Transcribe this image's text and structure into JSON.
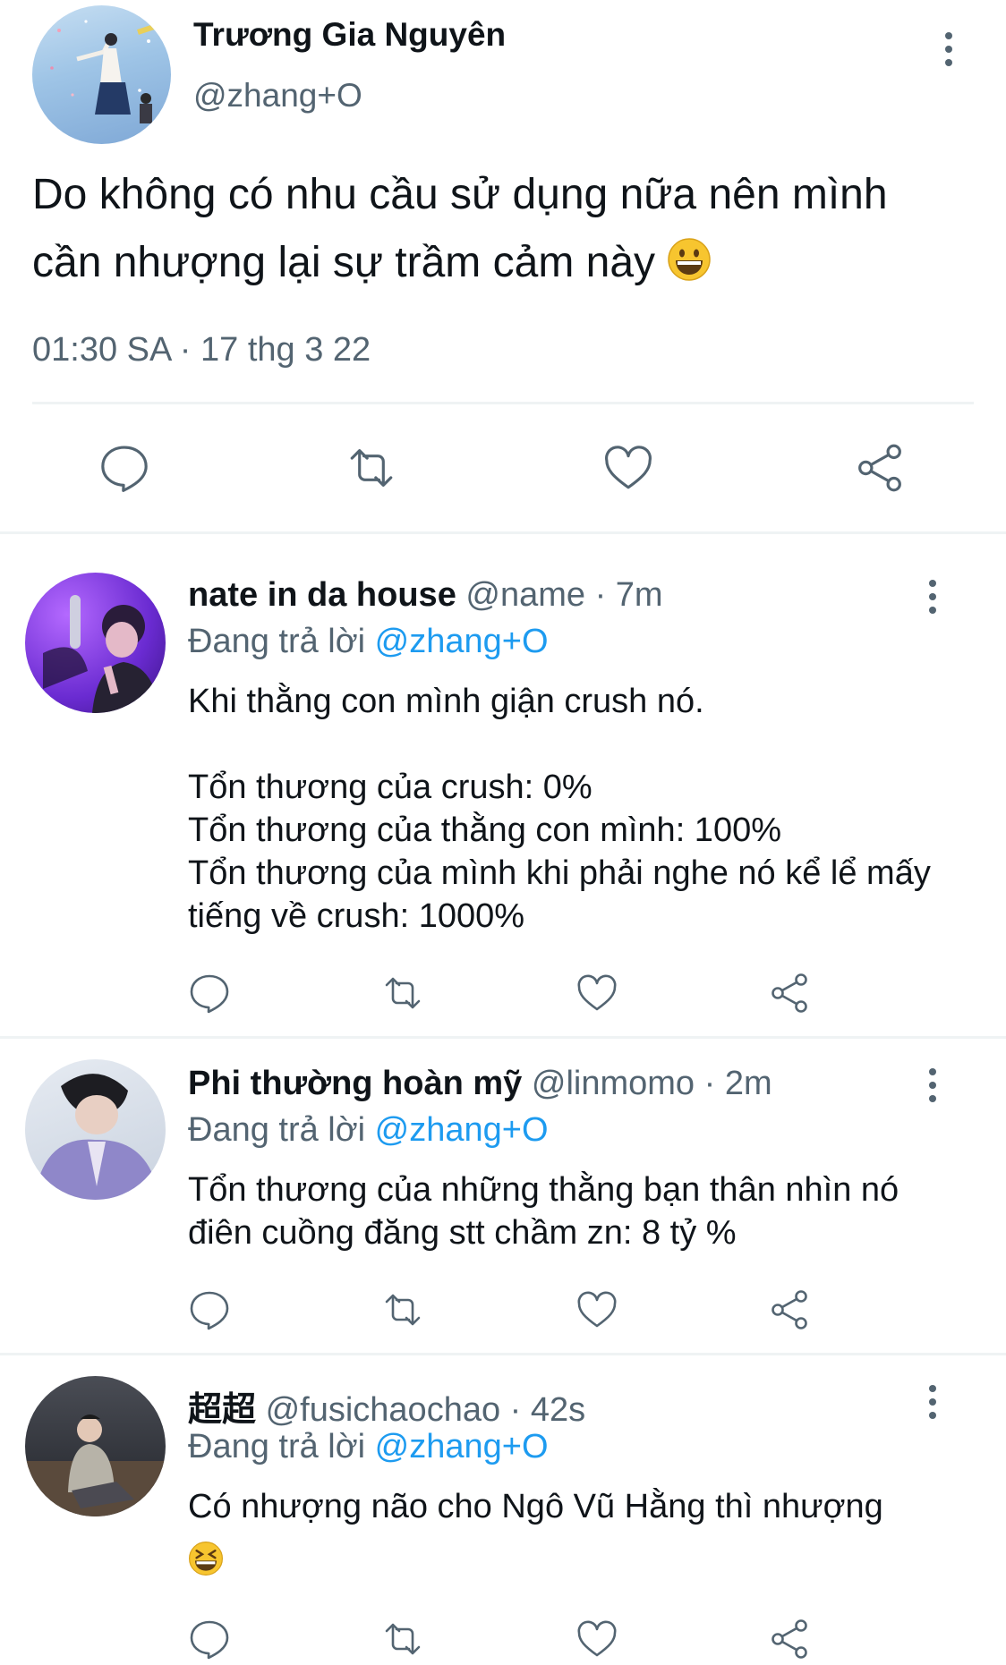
{
  "main_tweet": {
    "display_name": "Trương Gia Nguyên",
    "handle": "@zhang+O",
    "text": "Do không có nhu cầu sử dụng nữa nên mình cần nhượng lại sự trầm cảm này",
    "emoji": "😀",
    "timestamp": "01:30 SA · 17 thg 3 22"
  },
  "replies": [
    {
      "display_name": "nate in da house",
      "meta": "@name · 7m",
      "replying_label": "Đang trả lời",
      "replying_to": "@zhang+O",
      "text": "Khi thằng con mình giận crush nó.\n\nTổn thương của crush: 0%\nTổn thương của thằng con mình: 100%\nTổn thương của mình khi phải nghe  nó kể lể mấy tiếng về crush: 1000%"
    },
    {
      "display_name": "Phi thường hoàn mỹ",
      "meta": "@linmomo · 2m",
      "replying_label": "Đang trả lời",
      "replying_to": "@zhang+O",
      "text": "Tổn thương của những thằng bạn thân nhìn nó điên cuồng đăng stt chầm zn: 8 tỷ %"
    },
    {
      "display_name": "超超",
      "meta": "@fusichaochao · 42s",
      "replying_label": "Đang trả lời",
      "replying_to": "@zhang+O",
      "text": "Có nhượng não cho Ngô Vũ Hằng thì nhượng",
      "emoji": "😆"
    }
  ],
  "icons": {
    "reply": "speech-bubble-icon",
    "retweet": "retweet-icon",
    "like": "heart-icon",
    "share": "share-icon",
    "more": "kebab-menu-icon"
  },
  "colors": {
    "text": "#0f1419",
    "secondary": "#536471",
    "link": "#1d9bf0",
    "divider": "#eff3f4"
  }
}
